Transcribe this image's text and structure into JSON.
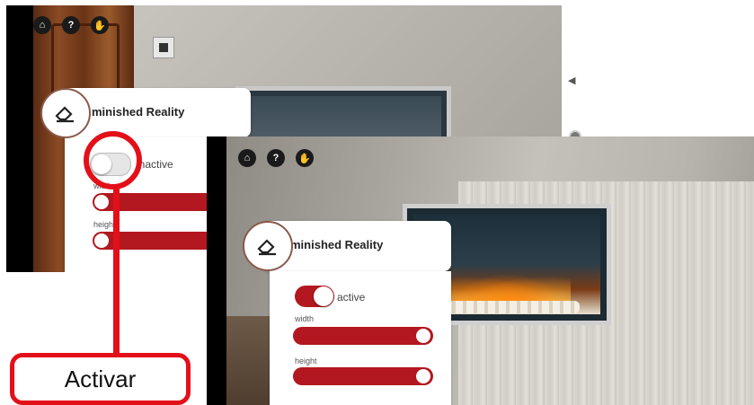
{
  "panel_before": {
    "title": "minished Reality",
    "toggle_label": "inactive",
    "width_label": "width",
    "height_label": "height",
    "active": false
  },
  "panel_after": {
    "title": "minished Reality",
    "toggle_label": "active",
    "width_label": "width",
    "height_label": "height",
    "active": true,
    "width_level": 1.0,
    "height_level": 1.0
  },
  "top_icons": [
    "home-icon",
    "help-icon",
    "hand-icon"
  ],
  "annotation": {
    "label": "Activar"
  },
  "colors": {
    "accent": "#b3171f",
    "callout": "#e3101a"
  }
}
